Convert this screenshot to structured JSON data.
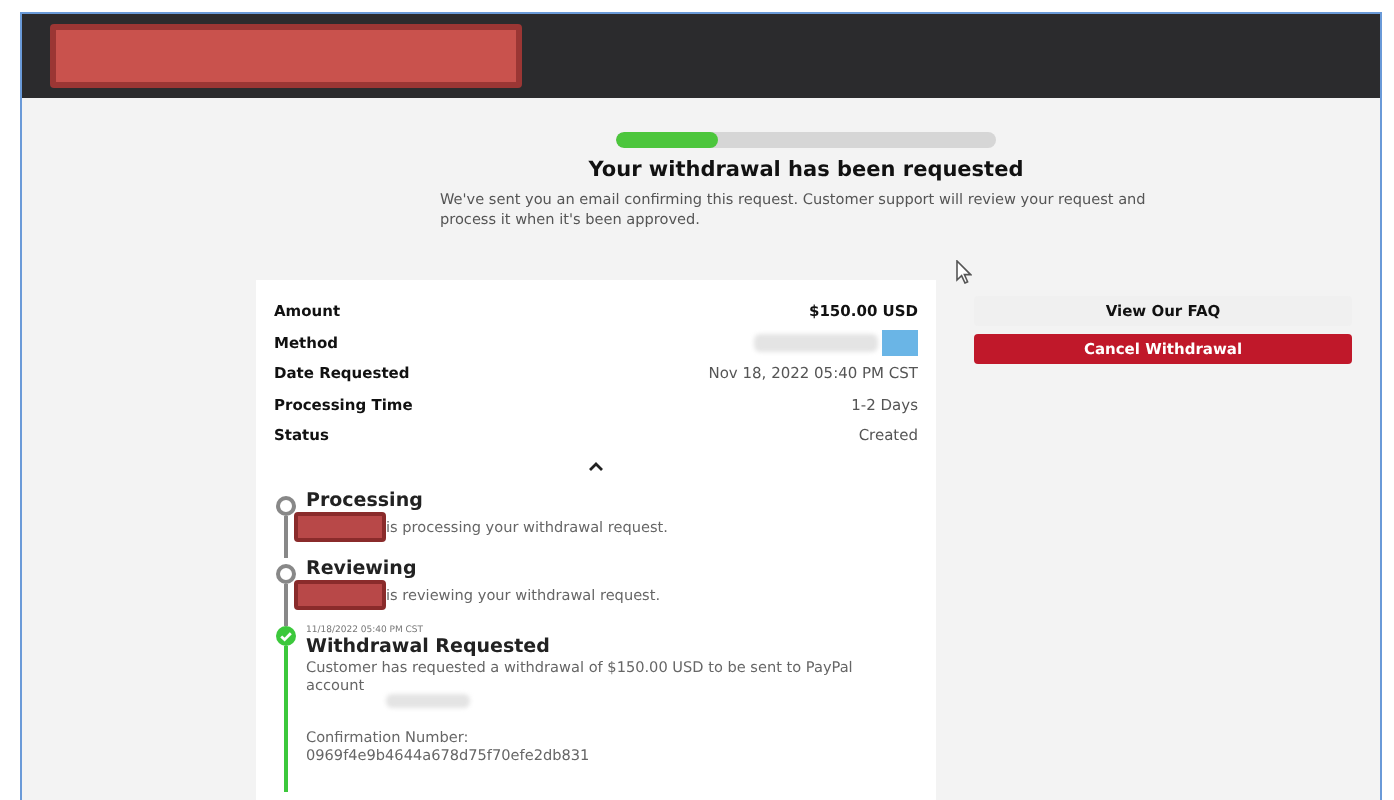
{
  "header": {
    "redacted": true
  },
  "progress": {
    "level": 0.27
  },
  "title": "Your withdrawal has been requested",
  "message": "We've sent you an email confirming this request. Customer support will review your request and process it when it's been approved.",
  "details": [
    {
      "label": "Amount",
      "value": "$150.00 USD",
      "kind": "strong"
    },
    {
      "label": "Method",
      "kind": "redacted"
    },
    {
      "label": "Date Requested",
      "value": "Nov 18, 2022 05:40 PM CST",
      "kind": "plain"
    },
    {
      "label": "Processing Time",
      "value": "1-2 Days",
      "kind": "plain"
    },
    {
      "label": "Status",
      "value": "Created",
      "kind": "plain"
    }
  ],
  "details_expanded": true,
  "steps": [
    {
      "kind": "pending",
      "title": "Processing",
      "description": "is processing your withdrawal request."
    },
    {
      "kind": "pending",
      "title": "Reviewing",
      "description": "is reviewing your withdrawal request."
    },
    {
      "kind": "done",
      "date": "11/18/2022 05:40 PM CST",
      "title": "Withdrawal Requested",
      "description": "Customer has requested a withdrawal of $150.00 USD to be sent to PayPal account",
      "confirmation_label": "Confirmation Number:",
      "confirmation_number": "0969f4e9b4644a678d75f70efe2db831"
    }
  ],
  "actions": [
    {
      "label": "View Our FAQ",
      "kind": "secondary"
    },
    {
      "label": "Cancel Withdrawal",
      "kind": "danger"
    }
  ]
}
